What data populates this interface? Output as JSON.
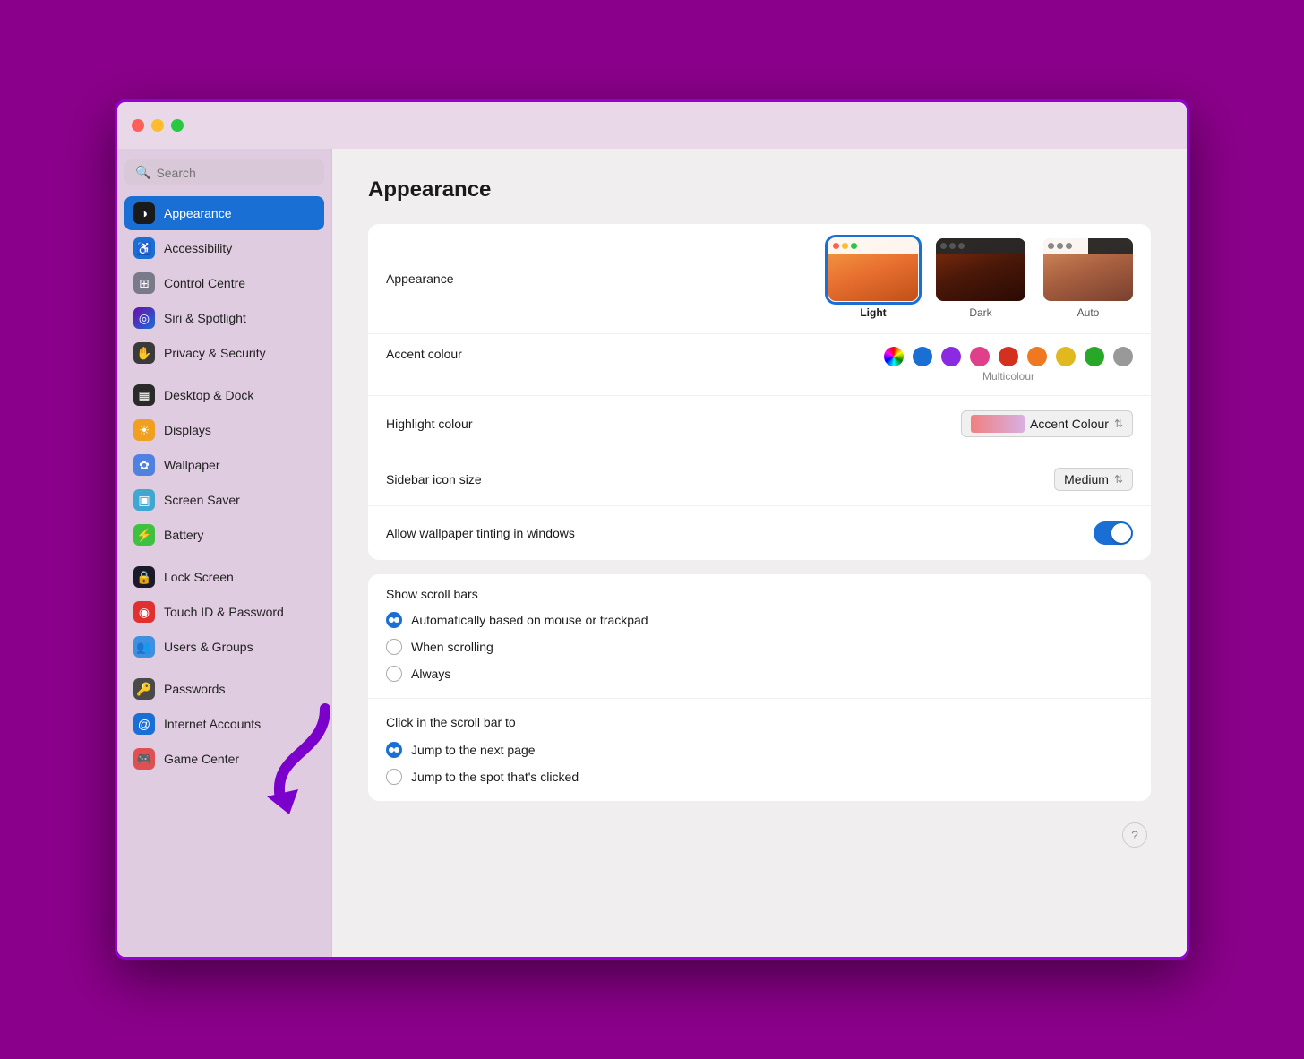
{
  "window": {
    "title": "Appearance"
  },
  "trafficLights": {
    "close": "close",
    "minimize": "minimize",
    "maximize": "maximize"
  },
  "sidebar": {
    "search": {
      "placeholder": "Search",
      "value": ""
    },
    "items": [
      {
        "id": "appearance",
        "label": "Appearance",
        "icon": "◑",
        "iconBg": "#1a1a1a",
        "active": true
      },
      {
        "id": "accessibility",
        "label": "Accessibility",
        "icon": "♿",
        "iconBg": "#1a6fd4",
        "active": false
      },
      {
        "id": "control-centre",
        "label": "Control Centre",
        "icon": "⊞",
        "iconBg": "#7a7a8a",
        "active": false
      },
      {
        "id": "siri-spotlight",
        "label": "Siri & Spotlight",
        "icon": "◎",
        "iconBg": "#6a3ad4",
        "active": false
      },
      {
        "id": "privacy-security",
        "label": "Privacy & Security",
        "icon": "✋",
        "iconBg": "#4a4a5a",
        "active": false
      },
      {
        "id": "desktop-dock",
        "label": "Desktop & Dock",
        "icon": "▦",
        "iconBg": "#2a2a2a",
        "active": false
      },
      {
        "id": "displays",
        "label": "Displays",
        "icon": "☀",
        "iconBg": "#f0a020",
        "active": false
      },
      {
        "id": "wallpaper",
        "label": "Wallpaper",
        "icon": "✿",
        "iconBg": "#5080e0",
        "active": false
      },
      {
        "id": "screen-saver",
        "label": "Screen Saver",
        "icon": "▣",
        "iconBg": "#40a8d0",
        "active": false
      },
      {
        "id": "battery",
        "label": "Battery",
        "icon": "⚡",
        "iconBg": "#40c040",
        "active": false
      },
      {
        "id": "lock-screen",
        "label": "Lock Screen",
        "icon": "⊞",
        "iconBg": "#1a1a2a",
        "active": false
      },
      {
        "id": "touch-id",
        "label": "Touch ID & Password",
        "icon": "◉",
        "iconBg": "#e03030",
        "active": false
      },
      {
        "id": "users-groups",
        "label": "Users & Groups",
        "icon": "👥",
        "iconBg": "#4090e0",
        "active": false
      },
      {
        "id": "passwords",
        "label": "Passwords",
        "icon": "🔑",
        "iconBg": "#4a4a4a",
        "active": false
      },
      {
        "id": "internet-accounts",
        "label": "Internet Accounts",
        "icon": "@",
        "iconBg": "#1a6fd4",
        "active": false
      },
      {
        "id": "game-center",
        "label": "Game Center",
        "icon": "🎮",
        "iconBg": "#e05050",
        "active": false
      }
    ]
  },
  "main": {
    "title": "Appearance",
    "sections": {
      "appearanceMode": {
        "label": "Appearance",
        "options": [
          {
            "id": "light",
            "label": "Light",
            "selected": true
          },
          {
            "id": "dark",
            "label": "Dark",
            "selected": false
          },
          {
            "id": "auto",
            "label": "Auto",
            "selected": false
          }
        ]
      },
      "accentColour": {
        "label": "Accent colour",
        "selectedLabel": "Multicolour",
        "colors": [
          {
            "id": "multicolor",
            "color": "conic-gradient"
          },
          {
            "id": "blue",
            "color": "#1a6fd4"
          },
          {
            "id": "purple",
            "color": "#8a2be2"
          },
          {
            "id": "pink",
            "color": "#e0408a"
          },
          {
            "id": "red",
            "color": "#d43020"
          },
          {
            "id": "orange",
            "color": "#f07820"
          },
          {
            "id": "yellow",
            "color": "#e0b820"
          },
          {
            "id": "green",
            "color": "#28a828"
          },
          {
            "id": "graphite",
            "color": "#999999"
          }
        ]
      },
      "highlightColour": {
        "label": "Highlight colour",
        "value": "Accent Colour"
      },
      "sidebarIconSize": {
        "label": "Sidebar icon size",
        "value": "Medium"
      },
      "wallpaperTinting": {
        "label": "Allow wallpaper tinting in windows",
        "enabled": true
      },
      "showScrollBars": {
        "title": "Show scroll bars",
        "options": [
          {
            "id": "auto",
            "label": "Automatically based on mouse or trackpad",
            "selected": true
          },
          {
            "id": "scrolling",
            "label": "When scrolling",
            "selected": false
          },
          {
            "id": "always",
            "label": "Always",
            "selected": false
          }
        ]
      },
      "scrollBarClick": {
        "title": "Click in the scroll bar to",
        "options": [
          {
            "id": "next-page",
            "label": "Jump to the next page",
            "selected": true
          },
          {
            "id": "clicked-spot",
            "label": "Jump to the spot that's clicked",
            "selected": false
          }
        ]
      }
    }
  },
  "helpButton": "?"
}
